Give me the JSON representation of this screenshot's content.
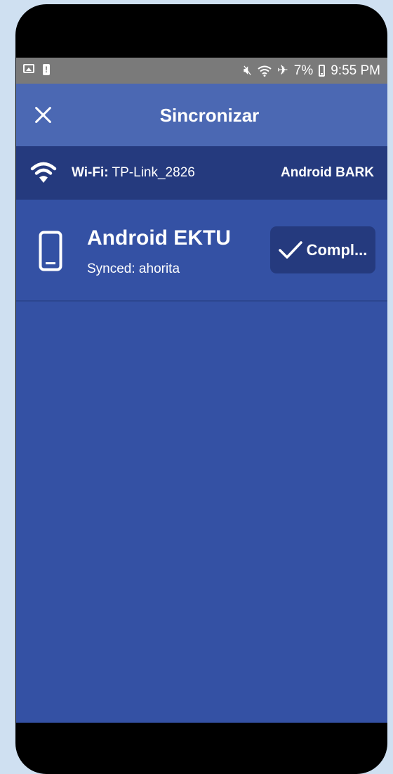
{
  "status_bar": {
    "battery": "7%",
    "time": "9:55 PM",
    "icons": [
      "image-icon",
      "alert-icon",
      "mute-icon",
      "wifi-icon",
      "airplane-icon",
      "battery-icon"
    ]
  },
  "app_bar": {
    "title": "Sincronizar",
    "close_icon": "close-icon"
  },
  "wifi_bar": {
    "label": "Wi-Fi:",
    "network": "TP-Link_2826",
    "device": "Android BARK"
  },
  "device": {
    "name": "Android EKTU",
    "status": "Synced: ahorita",
    "button_label": "Compl..."
  },
  "colors": {
    "background": "#3451a4",
    "app_bar": "#4b68b3",
    "wifi_bar": "#253a7e",
    "button": "#253a7e",
    "status_bar": "#7a7a7a"
  }
}
